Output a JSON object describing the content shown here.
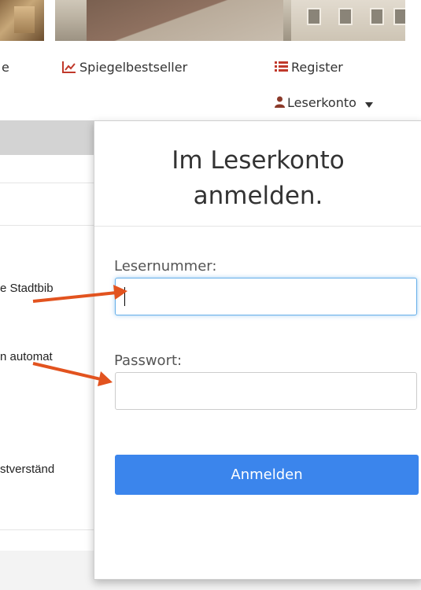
{
  "nav": {
    "partial_item": "e",
    "spiegel_label": "Spiegelbestseller",
    "register_label": "Register",
    "leserkonto_label": "Leserkonto"
  },
  "background": {
    "line1": "e Stadtbib",
    "line2": "n automat",
    "line3": "stverständ"
  },
  "login": {
    "title_line1": "Im Leserkonto",
    "title_line2": "anmelden.",
    "user_label": "Lesernummer:",
    "user_value": "",
    "password_label": "Passwort:",
    "password_value": "",
    "submit_label": "Anmelden"
  },
  "colors": {
    "button": "#3b85ec",
    "arrow": "#e2531f",
    "focus_border": "#66afe9",
    "chart_icon": "#c0392b",
    "register_icon": "#c0392b",
    "user_icon": "#8b3a2a"
  },
  "icons": [
    "line-chart-icon",
    "list-icon",
    "user-icon",
    "caret-down-icon",
    "annotation-arrow"
  ]
}
